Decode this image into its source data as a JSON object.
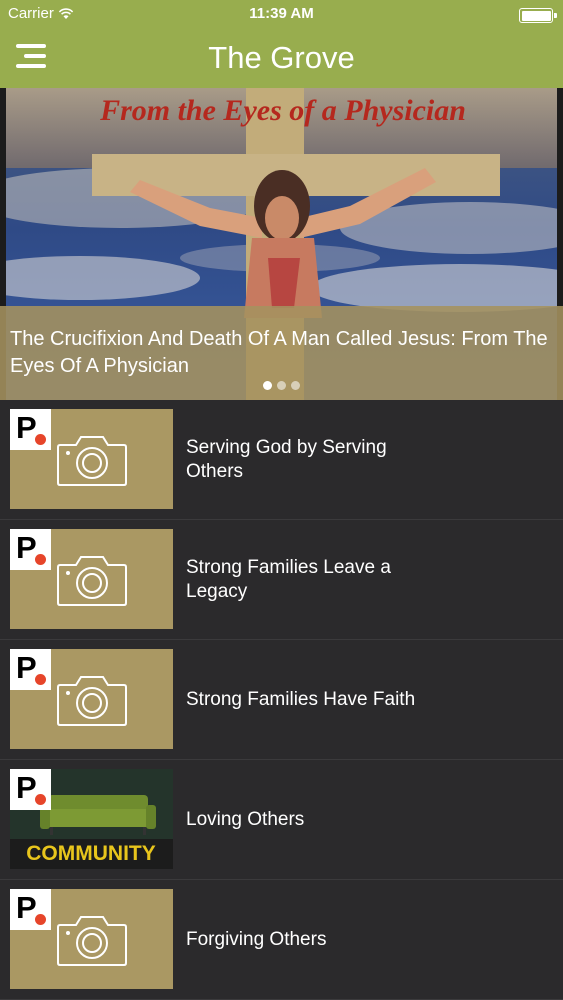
{
  "status_bar": {
    "carrier": "Carrier",
    "time": "11:39 AM"
  },
  "header": {
    "title": "The Grove",
    "menu_icon": "menu-icon"
  },
  "hero": {
    "image_text": "From the Eyes of a Physician",
    "caption": "The Crucifixion And Death Of A Man Called Jesus: From The Eyes Of A Physician",
    "pages": 3,
    "active_page": 1
  },
  "colors": {
    "header": "#98ad4e",
    "list_background": "#2b2a2c",
    "thumbnail": "#aa9863",
    "badge_dot": "#e6452a"
  },
  "items": [
    {
      "title": "Serving God by Serving Others",
      "thumbnail": "camera-placeholder",
      "badge": "P"
    },
    {
      "title": "Strong Families Leave a Legacy",
      "thumbnail": "camera-placeholder",
      "badge": "P"
    },
    {
      "title": "Strong Families Have Faith",
      "thumbnail": "camera-placeholder",
      "badge": "P"
    },
    {
      "title": "Loving Others",
      "thumbnail": "community-image",
      "thumbnail_text": "COMMUNITY",
      "badge": "P"
    },
    {
      "title": "Forgiving Others",
      "thumbnail": "camera-placeholder",
      "badge": "P"
    }
  ]
}
